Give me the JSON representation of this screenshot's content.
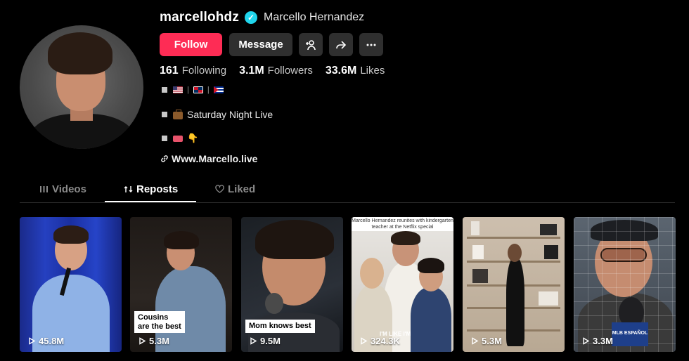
{
  "profile": {
    "username": "marcellohdz",
    "display_name": "Marcello Hernandez",
    "verified": true
  },
  "actions": {
    "follow_label": "Follow",
    "message_label": "Message"
  },
  "stats": {
    "following_count": "161",
    "following_label": "Following",
    "followers_count": "3.1M",
    "followers_label": "Followers",
    "likes_count": "33.6M",
    "likes_label": "Likes"
  },
  "bio": {
    "line2_text": "Saturday Night Live",
    "link_text": "Www.Marcello.live"
  },
  "tabs": [
    {
      "label": "Videos",
      "active": false
    },
    {
      "label": "Reposts",
      "active": true
    },
    {
      "label": "Liked",
      "active": false
    }
  ],
  "videos": [
    {
      "views": "45.8M",
      "caption": ""
    },
    {
      "views": "5.3M",
      "caption": "Cousins are the best"
    },
    {
      "views": "9.5M",
      "caption": "Mom knows best"
    },
    {
      "views": "324.3K",
      "caption": "",
      "top_caption": "Marcello Hernandez reunites with kindergarten teacher at the Netflix special",
      "overlay": "I'M LIKE I'M"
    },
    {
      "views": "5.3M",
      "caption": ""
    },
    {
      "views": "3.3M",
      "caption": "",
      "mic_brand": "MLB ESPAÑOL"
    }
  ],
  "colors": {
    "accent": "#fe2c55",
    "verified": "#20d5ec",
    "button_dark": "#2f2f2f"
  }
}
